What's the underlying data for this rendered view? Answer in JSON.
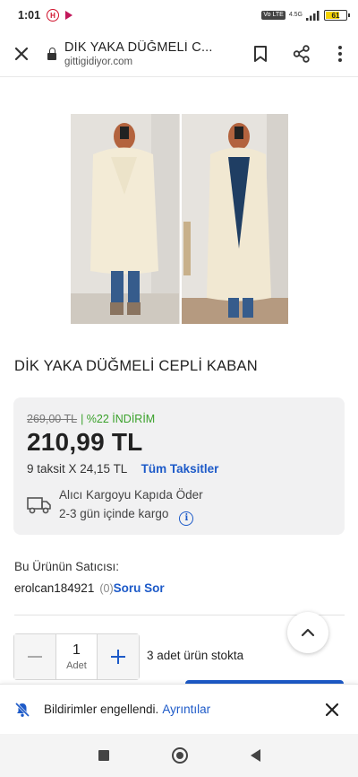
{
  "status_bar": {
    "time": "1:01",
    "network": "4.5G",
    "volte": "Vo LTE",
    "battery": "61"
  },
  "browser": {
    "page_title": "DİK YAKA DÜĞMELİ C...",
    "domain": "gittigidiyor.com",
    "icons": [
      "close-icon",
      "lock-icon",
      "bookmark-icon",
      "share-icon",
      "more-vert-icon"
    ]
  },
  "product": {
    "title": "DİK YAKA DÜĞMELİ CEPLİ KABAN"
  },
  "pricing": {
    "old_price": "269,00 TL",
    "discount": "| %22 İNDİRİM",
    "price": "210,99 TL",
    "installment": "9 taksit X 24,15 TL",
    "installment_link": "Tüm Taksitler",
    "cargo_line1": "Alıcı Kargoyu Kapıda Öder",
    "cargo_line2": "2-3 gün içinde kargo"
  },
  "seller": {
    "heading": "Bu Ürünün Satıcısı:",
    "name": "erolcan184921",
    "rating_count": "(0)",
    "ask_link": "Soru Sor"
  },
  "quantity": {
    "value": "1",
    "unit": "Adet",
    "stock_text": "3 adet ürün stokta"
  },
  "notification": {
    "text": "Bildirimler engellendi.",
    "link": "Ayrıntılar"
  },
  "colors": {
    "link_blue": "#1d5ac8",
    "discount_green": "#3aa12b",
    "price_card_bg": "#f1f1f2"
  }
}
